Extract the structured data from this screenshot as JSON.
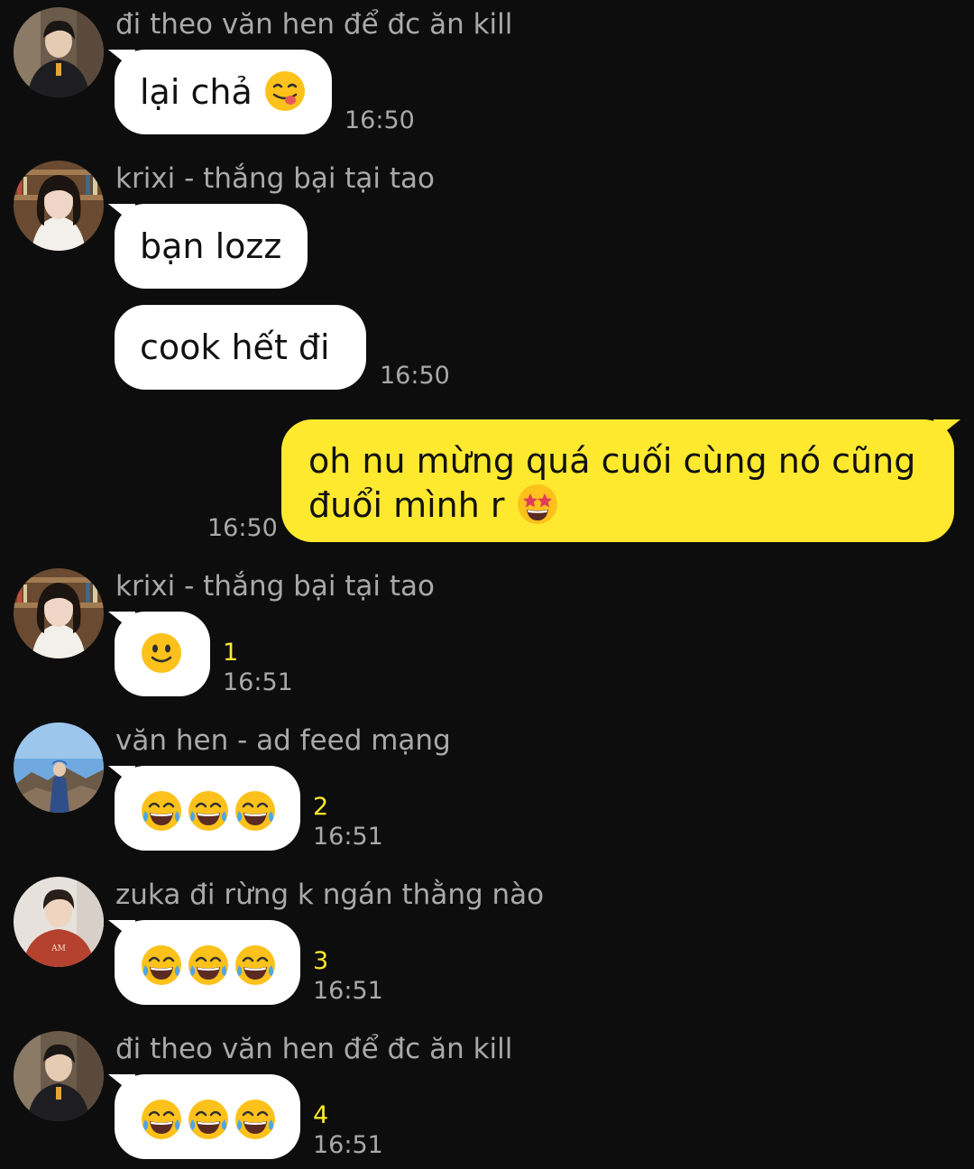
{
  "conversation": {
    "messages": [
      {
        "sender": "đi theo văn hen để đc ăn kill",
        "avatar": "avatar-boy-dark-jacket",
        "text": "lại chả",
        "emoji": "face-savoring-food-emoji",
        "time": "16:50"
      },
      {
        "sender": "krixi - thắng bại tại tao",
        "avatar": "avatar-girl-bookshelf",
        "texts": [
          "bạn lozz",
          "cook hết đi"
        ],
        "time": "16:50"
      },
      {
        "outgoing": true,
        "text_line1": "oh nu mừng quá cuối cùng nó cũng",
        "text_line2": "đuổi mình r",
        "emoji": "star-struck-emoji",
        "time": "16:50"
      },
      {
        "sender": "krixi - thắng bại tại tao",
        "avatar": "avatar-girl-bookshelf",
        "emoji": "slightly-smiling-face-emoji",
        "count": "1",
        "time": "16:51"
      },
      {
        "sender": "văn hen - ad feed mạng",
        "avatar": "avatar-mountain-blue-sky",
        "emoji": "tears-of-joy-emoji",
        "count": "2",
        "time": "16:51"
      },
      {
        "sender": "zuka đi rừng k ngán thằng nào",
        "avatar": "avatar-boy-red-hoodie",
        "emoji": "tears-of-joy-emoji",
        "count": "3",
        "time": "16:51"
      },
      {
        "sender": "đi theo văn hen để đc ăn kill",
        "avatar": "avatar-boy-dark-jacket",
        "emoji": "tears-of-joy-emoji",
        "count": "4",
        "time": "16:51"
      }
    ]
  },
  "colors": {
    "background": "#0d0d0d",
    "incoming_bubble": "#ffffff",
    "outgoing_bubble": "#ffe92f",
    "sender_name": "#a9a9a9",
    "timestamp": "#a9a9a9",
    "read_count": "#ffe92f"
  }
}
